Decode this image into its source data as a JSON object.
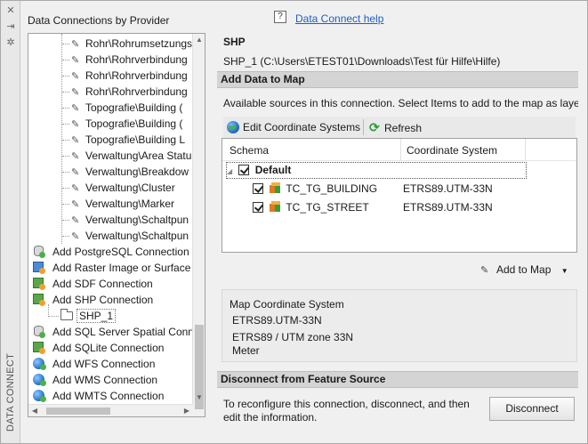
{
  "left_panel": {
    "title": "Data Connections by Provider",
    "vertical_label": "DATA CONNECT",
    "tree_items": [
      {
        "label": "Rohr\\Rohrumsetzungs",
        "kind": "child"
      },
      {
        "label": "Rohr\\Rohrverbindung",
        "kind": "child"
      },
      {
        "label": "Rohr\\Rohrverbindung",
        "kind": "child"
      },
      {
        "label": "Rohr\\Rohrverbindung",
        "kind": "child"
      },
      {
        "label": "Topografie\\Building (",
        "kind": "child"
      },
      {
        "label": "Topografie\\Building (",
        "kind": "child"
      },
      {
        "label": "Topografie\\Building L",
        "kind": "child"
      },
      {
        "label": "Verwaltung\\Area Statu",
        "kind": "child"
      },
      {
        "label": "Verwaltung\\Breakdow",
        "kind": "child"
      },
      {
        "label": "Verwaltung\\Cluster",
        "kind": "child"
      },
      {
        "label": "Verwaltung\\Marker",
        "kind": "child"
      },
      {
        "label": "Verwaltung\\Schaltpun",
        "kind": "child"
      },
      {
        "label": "Verwaltung\\Schaltpun",
        "kind": "child"
      },
      {
        "label": "Add PostgreSQL Connection",
        "kind": "provider",
        "icon": "database-icon"
      },
      {
        "label": "Add Raster Image or Surface C",
        "kind": "provider",
        "icon": "raster-icon"
      },
      {
        "label": "Add SDF Connection",
        "kind": "provider",
        "icon": "sdf-icon"
      },
      {
        "label": "Add SHP Connection",
        "kind": "provider",
        "icon": "shp-icon"
      },
      {
        "label": "SHP_1",
        "kind": "connection",
        "icon": "folder-icon"
      },
      {
        "label": "Add SQL Server Spatial Conne",
        "kind": "provider",
        "icon": "database-icon"
      },
      {
        "label": "Add SQLite Connection",
        "kind": "provider",
        "icon": "sqlite-icon"
      },
      {
        "label": "Add WFS Connection",
        "kind": "provider",
        "icon": "globe-icon"
      },
      {
        "label": "Add WMS Connection",
        "kind": "provider",
        "icon": "globe-icon"
      },
      {
        "label": "Add WMTS Connection",
        "kind": "provider",
        "icon": "globe-icon"
      }
    ]
  },
  "header": {
    "help_link": "Data Connect help",
    "help_icon": "?"
  },
  "connection": {
    "title": "SHP",
    "path": "SHP_1 (C:\\Users\\ETEST01\\Downloads\\Test für Hilfe\\Hilfe)"
  },
  "add_data": {
    "section_title": "Add Data to Map",
    "available_text": "Available sources in this connection.  Select Items to add to the map as laye",
    "toolbar": {
      "edit_cs_label": "Edit Coordinate Systems",
      "refresh_label": "Refresh"
    },
    "grid": {
      "columns": [
        "Schema",
        "Coordinate System"
      ],
      "schema_name": "Default",
      "rows": [
        {
          "name": "TC_TG_BUILDING",
          "cs": "ETRS89.UTM-33N",
          "checked": true
        },
        {
          "name": "TC_TG_STREET",
          "cs": "ETRS89.UTM-33N",
          "checked": true
        }
      ]
    },
    "add_to_map_label": "Add to Map",
    "map_cs": {
      "label": "Map Coordinate System",
      "code": "ETRS89.UTM-33N",
      "description": "ETRS89 / UTM zone 33N",
      "unit": "Meter"
    }
  },
  "disconnect": {
    "section_title": "Disconnect from Feature Source",
    "text": "To reconfigure this connection, disconnect, and then edit the information.",
    "button_label": "Disconnect"
  },
  "colors": {
    "link": "#1f5fbf",
    "section_bg": "#d4d4d4",
    "panel_bg": "#f0f0f0"
  }
}
